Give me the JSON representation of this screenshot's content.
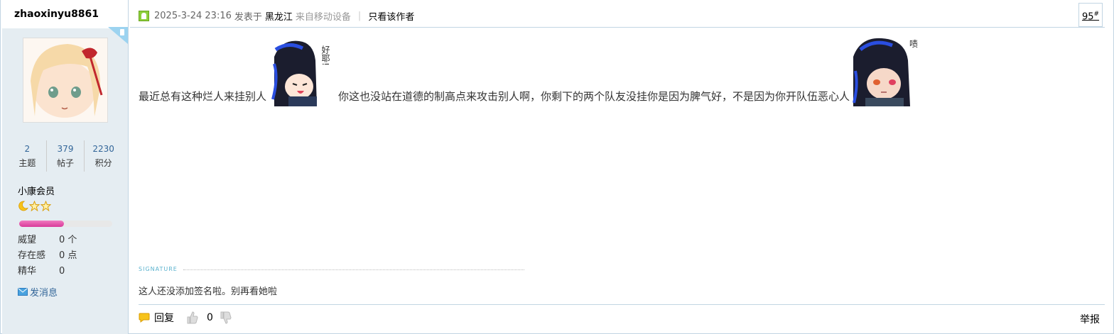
{
  "author": {
    "username": "zhaoxinyu8861",
    "stats": [
      {
        "value": "2",
        "label": "主题"
      },
      {
        "value": "379",
        "label": "帖子"
      },
      {
        "value": "2230",
        "label": "积分"
      }
    ],
    "rank": "小康会员",
    "level_progress_percent": 48,
    "attributes": [
      {
        "key": "威望",
        "value": "0 个"
      },
      {
        "key": "存在感",
        "value": "0 点"
      },
      {
        "key": "精华",
        "value": "0"
      }
    ],
    "send_message": "发消息"
  },
  "header": {
    "datetime": "2025-3-24 23:16",
    "posted_in": "发表于",
    "location": "黑龙江",
    "device": "来自移动设备",
    "only_author": "只看该作者",
    "floor_number": "95",
    "floor_suffix": "#"
  },
  "content": {
    "text1": "最近总有这种烂人来挂别人",
    "text2": "你这也没站在道德的制高点来攻击别人啊，你剩下的两个队友没挂你是因为脾气好，不是因为你开队伍恶心人",
    "sticker1_caption": "好耶!",
    "sticker2_caption": "啧"
  },
  "signature": {
    "label": "SIGNATURE",
    "text": "这人还没添加签名啦。别再看她啦"
  },
  "footer": {
    "reply": "回复",
    "like_count": "0",
    "report": "举报"
  },
  "colors": {
    "sidebar_bg": "#e5edf2",
    "border": "#c2d5e3",
    "link": "#336699",
    "signature_label": "#5ab2ce",
    "progress": "#e0489f"
  }
}
